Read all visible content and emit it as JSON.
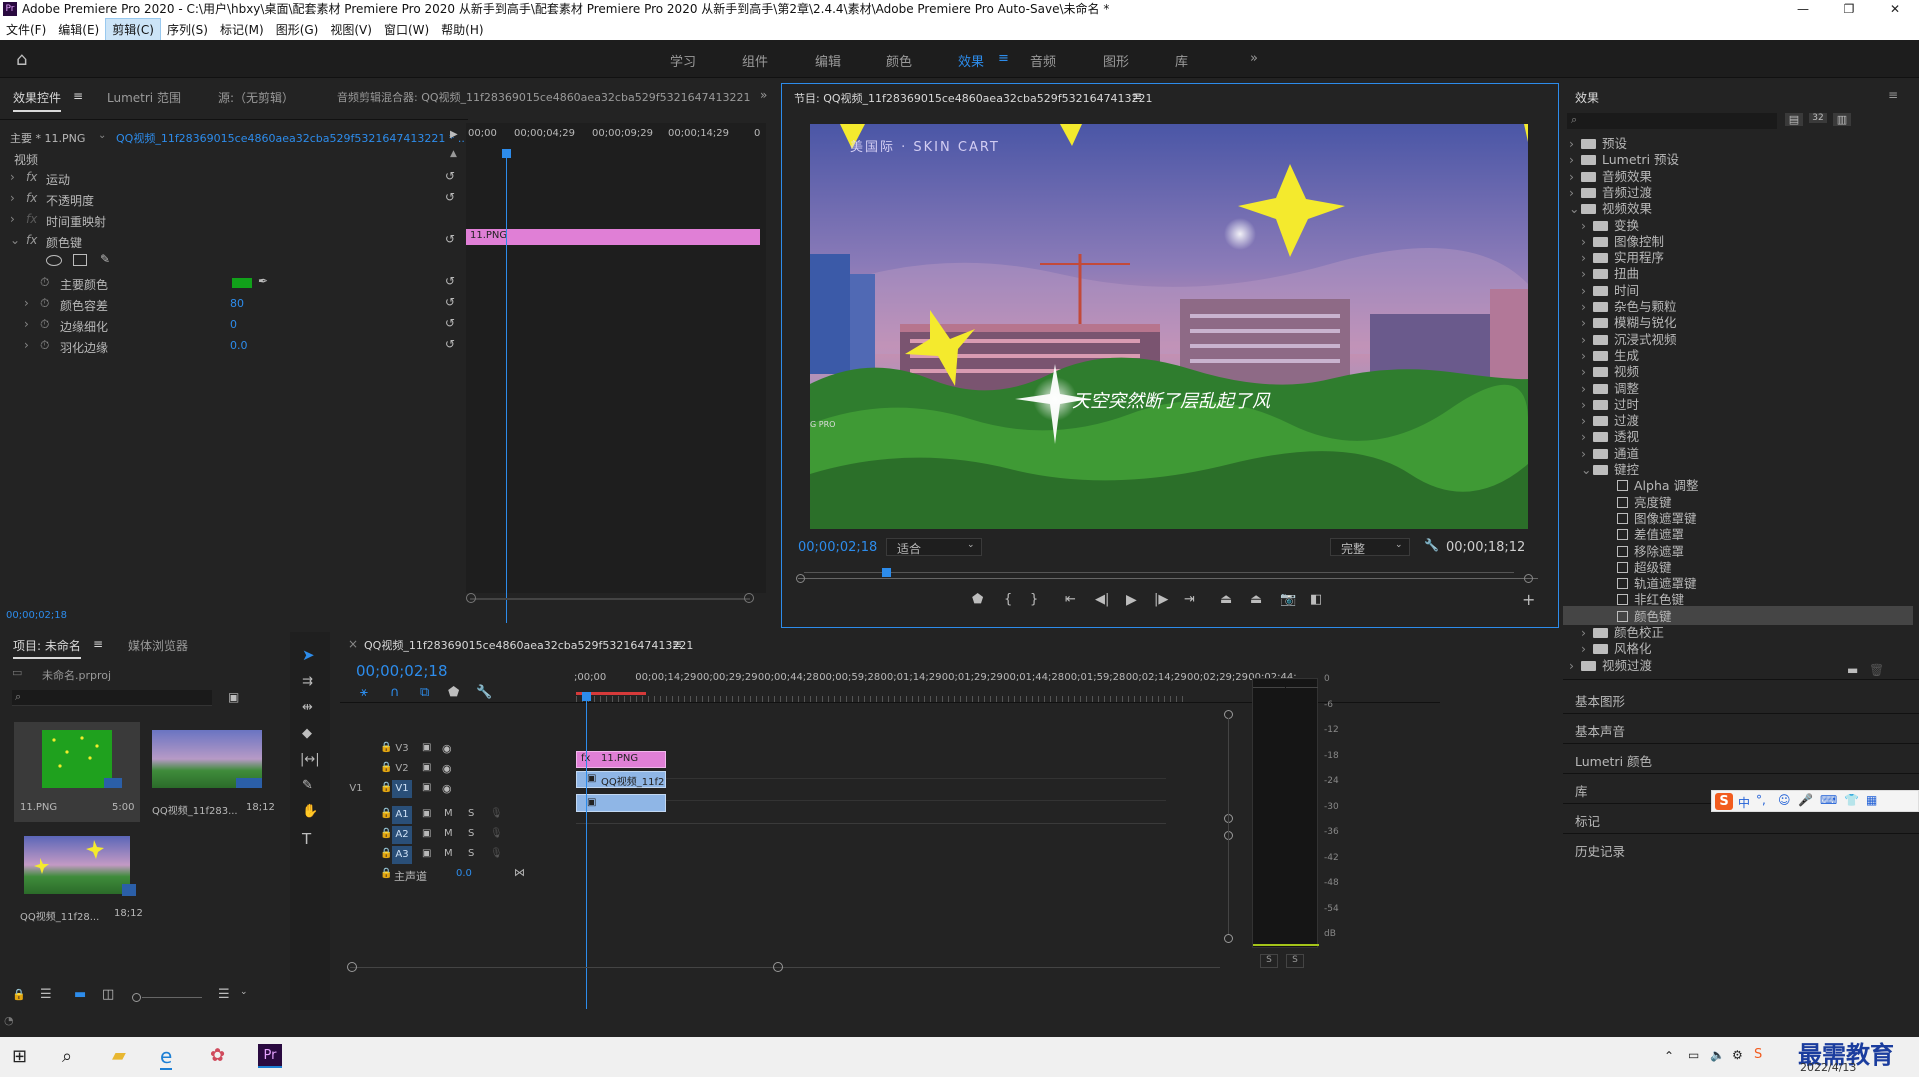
{
  "app": {
    "title": "Adobe Premiere Pro 2020 - C:\\用户\\hbxy\\桌面\\配套素材 Premiere Pro 2020 从新手到高手\\配套素材 Premiere Pro 2020 从新手到高手\\第2章\\2.4.4\\素材\\Adobe Premiere Pro Auto-Save\\未命名 *",
    "logo_text": "Pr"
  },
  "menu": [
    "文件(F)",
    "编辑(E)",
    "剪辑(C)",
    "序列(S)",
    "标记(M)",
    "图形(G)",
    "视图(V)",
    "窗口(W)",
    "帮助(H)"
  ],
  "workspaces": [
    "学习",
    "组件",
    "编辑",
    "颜色",
    "效果",
    "音频",
    "图形",
    "库"
  ],
  "effect_controls": {
    "tabs": [
      "效果控件",
      "Lumetri 范围",
      "源:（无剪辑）",
      "音频剪辑混合器: QQ视频_11f28369015ce4860aea32cba529f5321647413221"
    ],
    "master": "主要 * 11.PNG",
    "sequence": "QQ视频_11f28369015ce4860aea32cba529f5321647413221 * ...",
    "ruler": [
      "00;00",
      "00;00;04;29",
      "00;00;09;29",
      "00;00;14;29",
      "0"
    ],
    "clip": "11.PNG",
    "section": "视频",
    "items": [
      "运动",
      "不透明度",
      "时间重映射",
      "颜色键"
    ],
    "params": [
      {
        "label": "主要颜色",
        "value": ""
      },
      {
        "label": "颜色容差",
        "value": "80"
      },
      {
        "label": "边缘细化",
        "value": "0"
      },
      {
        "label": "羽化边缘",
        "value": "0.0"
      }
    ],
    "key_color": "#11a11a",
    "timecode": "00;00;02;18"
  },
  "program": {
    "title": "节目: QQ视频_11f28369015ce4860aea32cba529f5321647413221",
    "overlay_text": "天空突然断了层乱起了风",
    "watermark": "美国际 · SKIN CART",
    "corner_text": "G PRO",
    "timecode": "00;00;02;18",
    "fit": "适合",
    "quality": "完整",
    "duration": "00;00;18;12",
    "playhead_fraction": 0.14
  },
  "project": {
    "tabs": [
      "项目: 未命名",
      "媒体浏览器"
    ],
    "file": "未命名.prproj",
    "items": [
      {
        "name": "11.PNG",
        "dur": "5:00"
      },
      {
        "name": "QQ视频_11f283...",
        "dur": "18;12"
      },
      {
        "name": "QQ视频_11f28...",
        "dur": "18;12"
      }
    ]
  },
  "timeline": {
    "title": "QQ视频_11f28369015ce4860aea32cba529f5321647413221",
    "timecode": "00;00;02;18",
    "ruler": [
      ";00;00",
      "00;00;14;29",
      "00;00;29;29",
      "00;00;44;28",
      "00;00;59;28",
      "00;01;14;29",
      "00;01;29;29",
      "00;01;44;28",
      "00;01;59;28",
      "00;02;14;29",
      "00;02;29;29",
      "00;02;44;"
    ],
    "video_tracks": [
      "V3",
      "V2",
      "V1"
    ],
    "source_patch": "V1",
    "audio_tracks": [
      "A1",
      "A2",
      "A3"
    ],
    "master": "主声道",
    "master_value": "0.0",
    "clip_v2": "11.PNG",
    "clip_v1": "QQ视频_11f2",
    "meter_scale": [
      "0",
      "-6",
      "-12",
      "-18",
      "-24",
      "-30",
      "-36",
      "-42",
      "-48",
      "-54",
      "dB"
    ],
    "meter_buttons": [
      "S",
      "S"
    ]
  },
  "effects": {
    "title": "效果",
    "tree": [
      {
        "label": "预设",
        "level": 0,
        "open": false,
        "kind": "folder"
      },
      {
        "label": "Lumetri 预设",
        "level": 0,
        "open": false,
        "kind": "folder"
      },
      {
        "label": "音频效果",
        "level": 0,
        "open": false,
        "kind": "folder"
      },
      {
        "label": "音频过渡",
        "level": 0,
        "open": false,
        "kind": "folder"
      },
      {
        "label": "视频效果",
        "level": 0,
        "open": true,
        "kind": "folder"
      },
      {
        "label": "变换",
        "level": 1,
        "open": false,
        "kind": "folder"
      },
      {
        "label": "图像控制",
        "level": 1,
        "open": false,
        "kind": "folder"
      },
      {
        "label": "实用程序",
        "level": 1,
        "open": false,
        "kind": "folder"
      },
      {
        "label": "扭曲",
        "level": 1,
        "open": false,
        "kind": "folder"
      },
      {
        "label": "时间",
        "level": 1,
        "open": false,
        "kind": "folder"
      },
      {
        "label": "杂色与颗粒",
        "level": 1,
        "open": false,
        "kind": "folder"
      },
      {
        "label": "模糊与锐化",
        "level": 1,
        "open": false,
        "kind": "folder"
      },
      {
        "label": "沉浸式视频",
        "level": 1,
        "open": false,
        "kind": "folder"
      },
      {
        "label": "生成",
        "level": 1,
        "open": false,
        "kind": "folder"
      },
      {
        "label": "视频",
        "level": 1,
        "open": false,
        "kind": "folder"
      },
      {
        "label": "调整",
        "level": 1,
        "open": false,
        "kind": "folder"
      },
      {
        "label": "过时",
        "level": 1,
        "open": false,
        "kind": "folder"
      },
      {
        "label": "过渡",
        "level": 1,
        "open": false,
        "kind": "folder"
      },
      {
        "label": "透视",
        "level": 1,
        "open": false,
        "kind": "folder"
      },
      {
        "label": "通道",
        "level": 1,
        "open": false,
        "kind": "folder"
      },
      {
        "label": "键控",
        "level": 1,
        "open": true,
        "kind": "folder"
      },
      {
        "label": "Alpha 调整",
        "level": 2,
        "kind": "effect"
      },
      {
        "label": "亮度键",
        "level": 2,
        "kind": "effect"
      },
      {
        "label": "图像遮罩键",
        "level": 2,
        "kind": "effect"
      },
      {
        "label": "差值遮罩",
        "level": 2,
        "kind": "effect"
      },
      {
        "label": "移除遮罩",
        "level": 2,
        "kind": "effect"
      },
      {
        "label": "超级键",
        "level": 2,
        "kind": "effect"
      },
      {
        "label": "轨道遮罩键",
        "level": 2,
        "kind": "effect"
      },
      {
        "label": "非红色键",
        "level": 2,
        "kind": "effect"
      },
      {
        "label": "颜色键",
        "level": 2,
        "kind": "effect",
        "selected": true
      },
      {
        "label": "颜色校正",
        "level": 1,
        "open": false,
        "kind": "folder"
      },
      {
        "label": "风格化",
        "level": 1,
        "open": false,
        "kind": "folder"
      },
      {
        "label": "视频过渡",
        "level": 0,
        "open": false,
        "kind": "folder"
      }
    ],
    "sections": [
      "基本图形",
      "基本声音",
      "Lumetri 颜色",
      "库",
      "标记",
      "历史记录"
    ]
  },
  "ime": [
    "S",
    "中",
    "°,",
    "☺",
    "🎤",
    "⌨",
    "👕",
    "▦"
  ],
  "watermark": {
    "text": "最需教育",
    "date": "2022/4/13"
  },
  "colors": {
    "accent": "#2d8ceb",
    "pink_clip": "#e07fd6",
    "blue_clip": "#8fb6e6"
  }
}
